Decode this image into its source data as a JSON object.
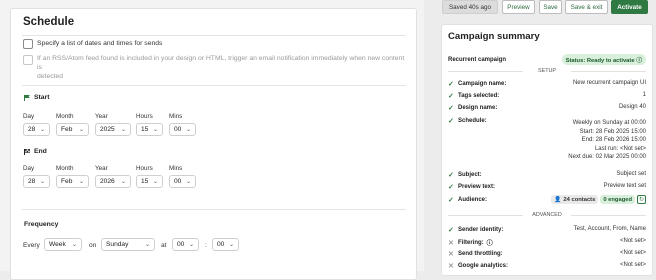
{
  "schedule": {
    "title": "Schedule",
    "opt_dates": "Specify a list of dates and times for sends",
    "opt_rss_line1": "If an RSS/Atom feed found is included in your design or HTML, trigger an email notification immediately when new content is",
    "opt_rss_line2": "detected",
    "start": {
      "label": "Start",
      "day_label": "Day",
      "month_label": "Month",
      "year_label": "Year",
      "hours_label": "Hours",
      "mins_label": "Mins",
      "day": "28",
      "month": "Feb",
      "year": "2025",
      "hours": "15",
      "mins": "00"
    },
    "end": {
      "label": "End",
      "day_label": "Day",
      "month_label": "Month",
      "year_label": "Year",
      "hours_label": "Hours",
      "mins_label": "Mins",
      "day": "28",
      "month": "Feb",
      "year": "2026",
      "hours": "15",
      "mins": "00"
    },
    "frequency": {
      "label": "Frequency",
      "every": "Every",
      "unit": "Week",
      "on": "on",
      "weekday": "Sunday",
      "at": "at",
      "hour": "00",
      "colon": ":",
      "minute": "00"
    }
  },
  "toolbar": {
    "saved": "Saved 40s ago",
    "preview": "Preview",
    "save": "Save",
    "save_exit": "Save & exit",
    "activate": "Activate"
  },
  "summary": {
    "title": "Campaign summary",
    "type": "Recurrent campaign",
    "status": "Status: Ready to activate",
    "setup": "SETUP",
    "advanced": "ADVANCED",
    "campaign_name_k": "Campaign name:",
    "campaign_name_v": "New recurrent campaign UI",
    "tags_k": "Tags selected:",
    "tags_v": "1",
    "design_k": "Design name:",
    "design_v": "Design 40",
    "schedule_k": "Schedule:",
    "schedule_lines": [
      "Weekly on Sunday at 00:00",
      "Start: 28 Feb 2025 15:00",
      "End: 28 Feb 2026 15:00",
      "Last run: <Not set>",
      "Next due: 02 Mar 2025 00:00"
    ],
    "subject_k": "Subject:",
    "subject_v": "Subject set",
    "preview_k": "Preview text:",
    "preview_v": "Preview text set",
    "audience_k": "Audience:",
    "contacts": "24 contacts",
    "engaged": "0 engaged",
    "sender_k": "Sender identity:",
    "sender_v": "Test, Account, From, Name",
    "filtering_k": "Filtering:",
    "filtering_v": "<Not set>",
    "throttling_k": "Send throttling:",
    "throttling_v": "<Not set>",
    "analytics_k": "Google analytics:",
    "analytics_v": "<Not set>"
  },
  "colors": {
    "accent": "#2f7a43",
    "status_bg": "#d8efdc"
  }
}
